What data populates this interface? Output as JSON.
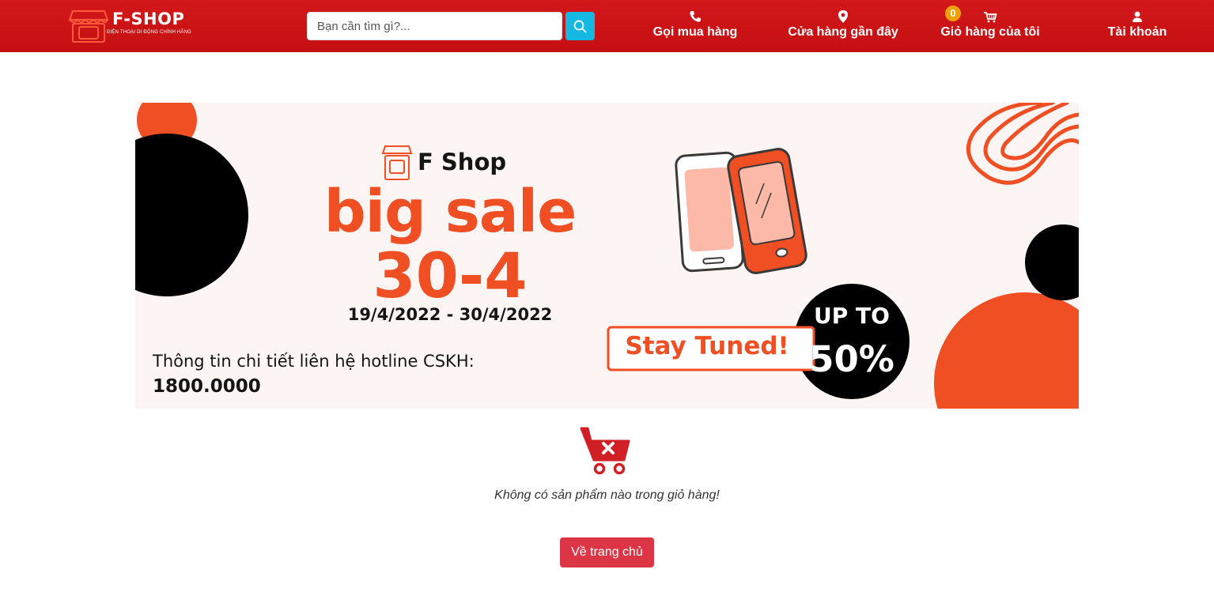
{
  "colors": {
    "header_red": "#c8121a",
    "accent_orange": "#f04e23",
    "search_blue": "#14b8e0",
    "badge_orange": "#f0a10a",
    "button_red": "#dc3545"
  },
  "header": {
    "logo": {
      "title": "F-SHOP",
      "subtitle": "ĐIỆN THOẠI DI ĐỘNG CHÍNH HÃNG",
      "icon": "storefront-icon"
    },
    "search": {
      "placeholder": "Bạn cần tìm gì?...",
      "value": "",
      "icon": "search-icon"
    },
    "nav": [
      {
        "label": "Gọi mua hàng",
        "icon": "phone-icon"
      },
      {
        "label": "Cửa hàng gần đây",
        "icon": "map-pin-icon"
      },
      {
        "label": "Giỏ hàng của tôi",
        "icon": "cart-icon",
        "badge": "0"
      },
      {
        "label": "Tài khoản",
        "icon": "user-icon"
      }
    ]
  },
  "banner": {
    "brand": "F Shop",
    "headline": "big sale",
    "date_big": "30-4",
    "date_range": "19/4/2022 - 30/4/2022",
    "contact_line": "Thông tin chi tiết liên hệ hotline CSKH:",
    "hotline": "1800.0000",
    "stay_tuned": "Stay Tuned!",
    "discount_top": "UP TO",
    "discount_value": "50%"
  },
  "cart": {
    "empty_icon": "cart-x-icon",
    "empty_message": "Không có sản phẩm nào trong giỏ hàng!",
    "home_button": "Về trang chủ"
  }
}
